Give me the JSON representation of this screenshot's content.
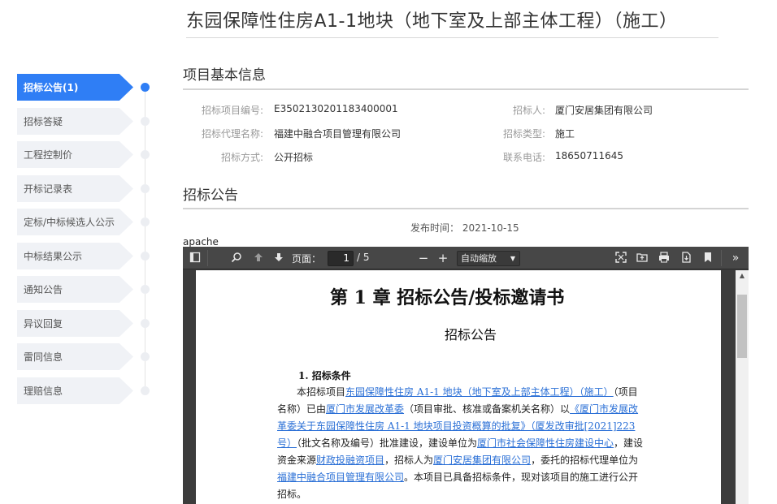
{
  "page": {
    "title": "东园保障性住房A1-1地块（地下室及上部主体工程）（施工）"
  },
  "sidebar": {
    "items": [
      {
        "label": "招标公告(1)",
        "active": true
      },
      {
        "label": "招标答疑",
        "active": false
      },
      {
        "label": "工程控制价",
        "active": false
      },
      {
        "label": "开标记录表",
        "active": false
      },
      {
        "label": "定标/中标候选人公示",
        "active": false
      },
      {
        "label": "中标结果公示",
        "active": false
      },
      {
        "label": "通知公告",
        "active": false
      },
      {
        "label": "异议回复",
        "active": false
      },
      {
        "label": "雷同信息",
        "active": false
      },
      {
        "label": "理赔信息",
        "active": false
      }
    ]
  },
  "basic_info": {
    "title": "项目基本信息",
    "project_no_label": "招标项目编号:",
    "project_no": "E3502130201183400001",
    "tenderer_label": "招标人:",
    "tenderer": "厦门安居集团有限公司",
    "agency_label": "招标代理名称:",
    "agency": "福建中融合项目管理有限公司",
    "type_label": "招标类型:",
    "type": "施工",
    "method_label": "招标方式:",
    "method": "公开招标",
    "phone_label": "联系电话:",
    "phone": "18650711645"
  },
  "announcement": {
    "title": "招标公告",
    "publish_label": "发布时间：",
    "publish_date": "2021-10-15",
    "apache": "apache"
  },
  "pdf": {
    "page_label": "页面：",
    "page_current": "1",
    "page_total": "/ 5",
    "zoom": "自动缩放",
    "heading": "第 1 章 招标公告/投标邀请书",
    "subheading": "招标公告",
    "section": "1. 招标条件",
    "t1": "本招标项目",
    "l1": "东园保障性住房 A1-1 地块（地下室及上部主体工程）（施工）",
    "t2": "（项目名称）已由",
    "l2": "厦门市发展改革委",
    "t3": "（项目审批、核准或备案机关名称）以",
    "l3": "《厦门市发展改革委关于东园保障性住房 A1-1 地块项目投资概算的批复》（厦发改审批[2021]223 号）",
    "t4": "（批文名称及编号）批准建设，建设单位为",
    "l4": "厦门市社会保障性住房建设中心",
    "t5": "，建设资金来源",
    "l5": "财政投融资项目",
    "t6": "，招标人为",
    "l6": "厦门安居集团有限公司",
    "t7": "，委托的招标代理单位为",
    "l7": "福建中融合项目管理有限公司",
    "t8": "。本项目已具备招标条件，现对该项目的施工进行公开招标。"
  },
  "colors": {
    "accent": "#2f7ef5",
    "link": "#2a6fd6"
  }
}
